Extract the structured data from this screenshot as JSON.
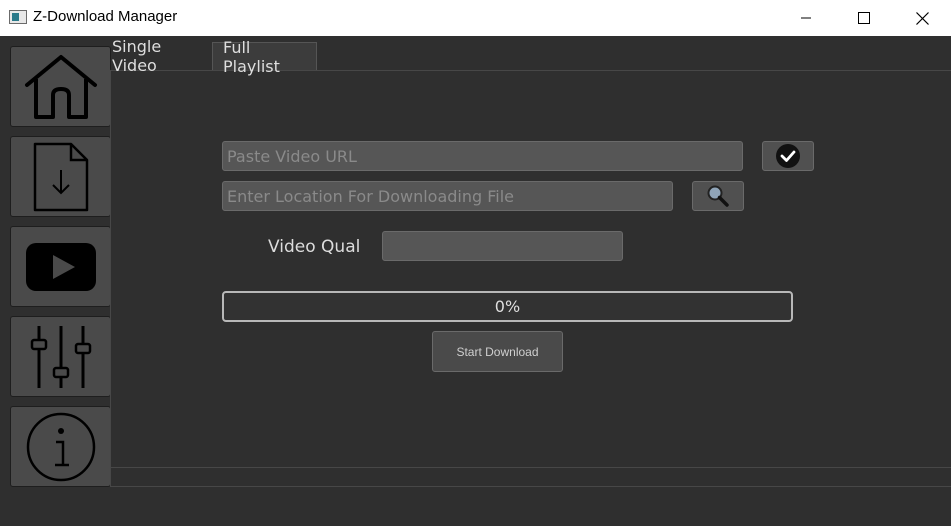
{
  "window": {
    "title": "Z-Download Manager",
    "controls": [
      "minimize",
      "maximize",
      "close"
    ]
  },
  "sidebar": {
    "items": [
      {
        "name": "home",
        "icon": "home-icon"
      },
      {
        "name": "downloads",
        "icon": "file-download-icon"
      },
      {
        "name": "youtube",
        "icon": "youtube-play-icon"
      },
      {
        "name": "settings",
        "icon": "sliders-icon"
      },
      {
        "name": "about",
        "icon": "info-icon"
      }
    ]
  },
  "tabs": [
    {
      "label": "Single Video",
      "active": true
    },
    {
      "label": "Full Playlist",
      "active": false
    }
  ],
  "form": {
    "url_placeholder": "Paste Video URL",
    "url_value": "",
    "location_placeholder": "Enter Location For Downloading File",
    "location_value": "",
    "quality_label": "Video Qual",
    "quality_value": "",
    "progress_percent": 0,
    "progress_text": "0%",
    "start_label": "Start Download"
  },
  "colors": {
    "background": "#2f2f2f",
    "sidebar_button": "#4a4a4a",
    "field": "#565656"
  }
}
